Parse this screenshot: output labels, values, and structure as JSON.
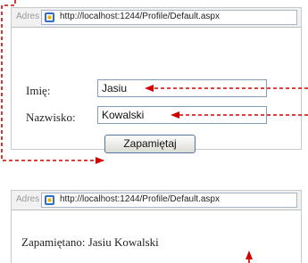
{
  "window1": {
    "address_label": "Adres",
    "url": "http://localhost:1244/Profile/Default.aspx",
    "form": {
      "first_name_label": "Imię:",
      "first_name_value": "Jasiu",
      "last_name_label": "Nazwisko:",
      "last_name_value": "Kowalski",
      "save_label": "Zapamiętaj"
    }
  },
  "window2": {
    "address_label": "Adres",
    "url": "http://localhost:1244/Profile/Default.aspx",
    "result": "Zapamiętano: Jasiu Kowalski"
  },
  "colors": {
    "annotation_arrow": "#d40000",
    "input_border": "#7f9db9"
  }
}
